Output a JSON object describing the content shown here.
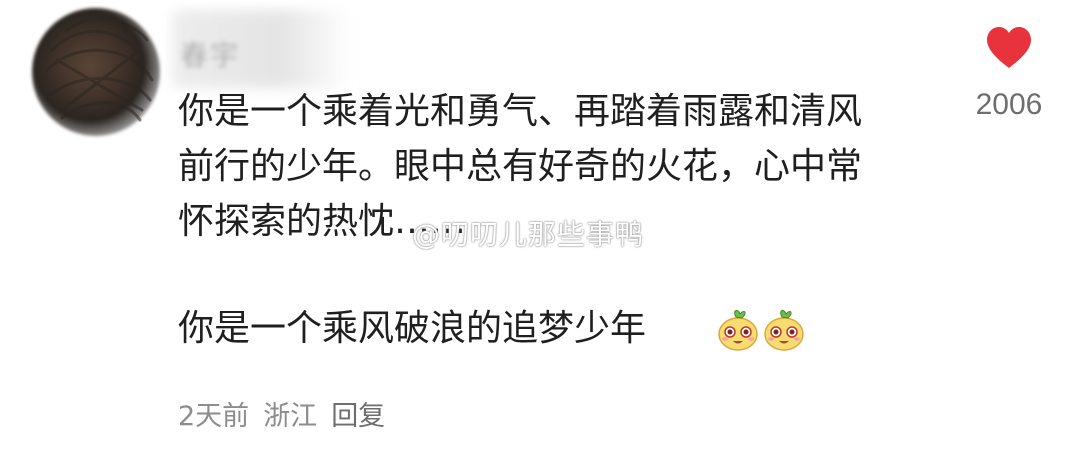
{
  "comment": {
    "username": "春宇",
    "content_lines": [
      "你是一个乘着光和勇气、再踏着雨露和清风",
      "前行的少年。眼中总有好奇的火花，心中常",
      "怀探索的热忱……"
    ],
    "content_line2": "你是一个乘风破浪的追梦少年",
    "emoji_count": 2,
    "emoji_icon": "happy-pear-face-emoji",
    "time": "2天前",
    "location": "浙江",
    "reply_label": "回复",
    "like_count": "2006",
    "like_color": "#e8323c"
  },
  "watermark": "@叨叨儿那些事鸭"
}
